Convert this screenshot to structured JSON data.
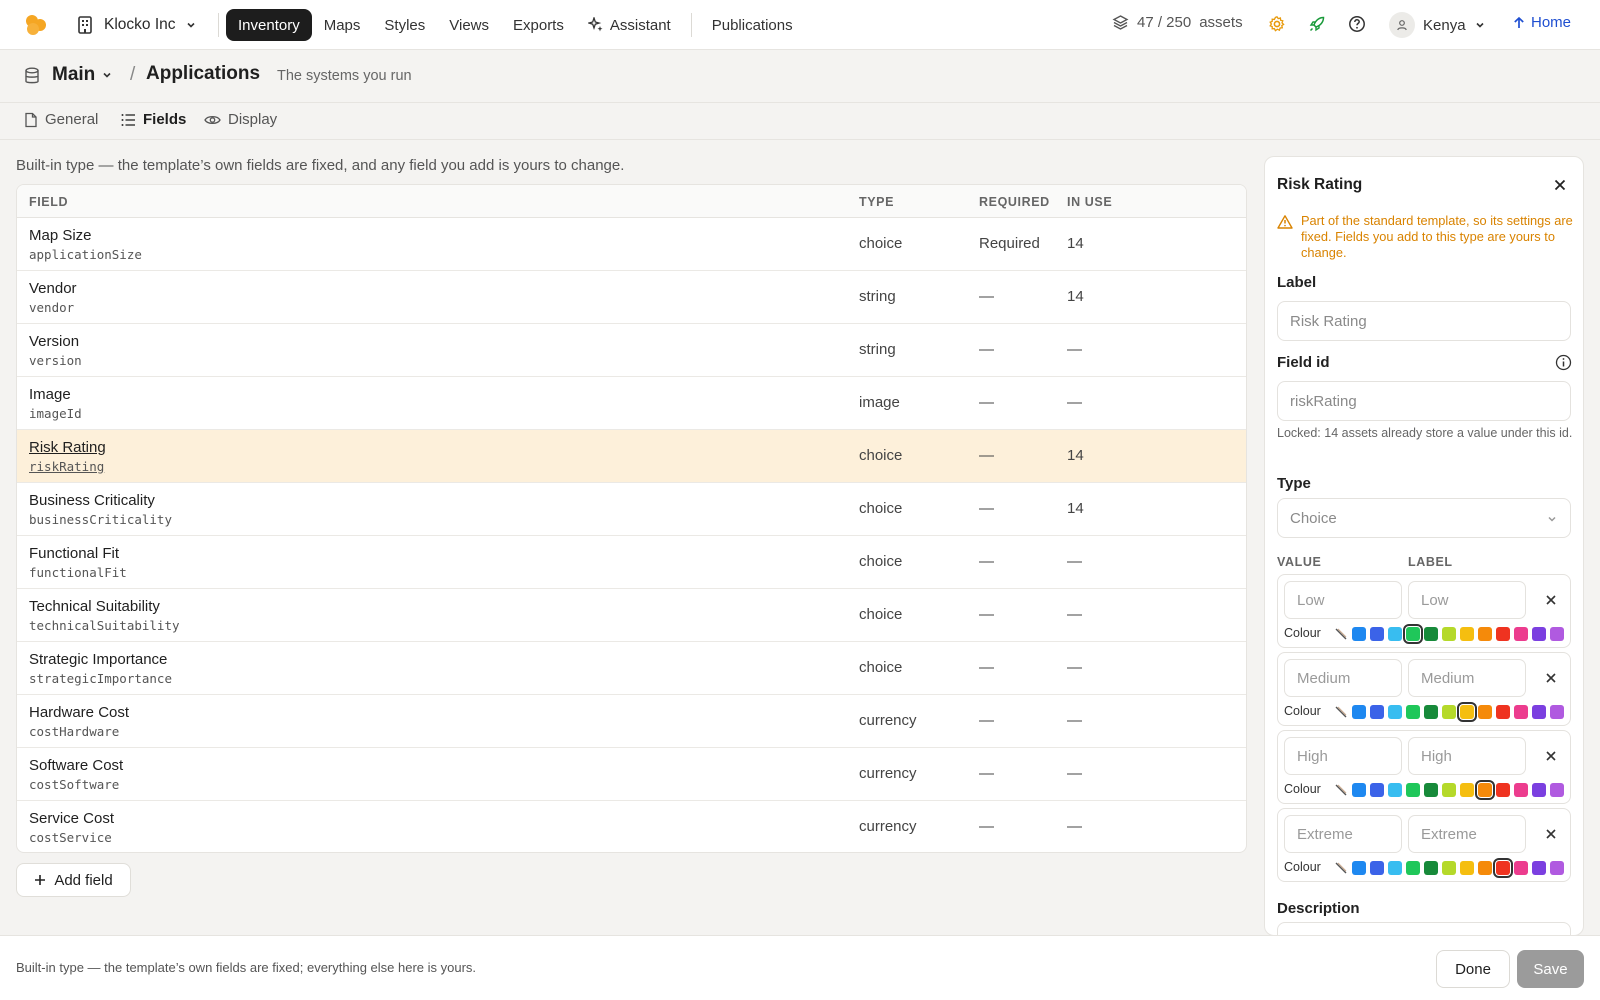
{
  "topbar": {
    "org": "Klocko Inc",
    "nav": [
      {
        "label": "Inventory",
        "active": true
      },
      {
        "label": "Maps"
      },
      {
        "label": "Styles"
      },
      {
        "label": "Views"
      },
      {
        "label": "Exports"
      },
      {
        "label": "Assistant"
      },
      {
        "label": "Publications"
      }
    ],
    "assets_count": "47 / 250",
    "assets_label": "assets",
    "user": "Kenya",
    "home": "Home"
  },
  "breadcrumb": {
    "root": "Main",
    "separator": "/",
    "page": "Applications",
    "subtitle": "The systems you run"
  },
  "tabs": [
    {
      "label": "General",
      "icon": "file-icon"
    },
    {
      "label": "Fields",
      "icon": "list-icon",
      "active": true
    },
    {
      "label": "Display",
      "icon": "eye-icon"
    }
  ],
  "notice": "Built-in type — the template’s own fields are fixed, and any field you add is yours to change.",
  "table": {
    "headers": {
      "field": "FIELD",
      "type": "TYPE",
      "required": "REQUIRED",
      "in_use": "IN USE"
    },
    "rows": [
      {
        "name": "Map Size",
        "id": "applicationSize",
        "type": "choice",
        "required": "Required",
        "in_use": "14"
      },
      {
        "name": "Vendor",
        "id": "vendor",
        "type": "string",
        "required": "—",
        "in_use": "14"
      },
      {
        "name": "Version",
        "id": "version",
        "type": "string",
        "required": "—",
        "in_use": "—"
      },
      {
        "name": "Image",
        "id": "imageId",
        "type": "image",
        "required": "—",
        "in_use": "—"
      },
      {
        "name": "Risk Rating",
        "id": "riskRating",
        "type": "choice",
        "required": "—",
        "in_use": "14",
        "selected": true
      },
      {
        "name": "Business Criticality",
        "id": "businessCriticality",
        "type": "choice",
        "required": "—",
        "in_use": "14"
      },
      {
        "name": "Functional Fit",
        "id": "functionalFit",
        "type": "choice",
        "required": "—",
        "in_use": "—"
      },
      {
        "name": "Technical Suitability",
        "id": "technicalSuitability",
        "type": "choice",
        "required": "—",
        "in_use": "—"
      },
      {
        "name": "Strategic Importance",
        "id": "strategicImportance",
        "type": "choice",
        "required": "—",
        "in_use": "—"
      },
      {
        "name": "Hardware Cost",
        "id": "costHardware",
        "type": "currency",
        "required": "—",
        "in_use": "—"
      },
      {
        "name": "Software Cost",
        "id": "costSoftware",
        "type": "currency",
        "required": "—",
        "in_use": "—"
      },
      {
        "name": "Service Cost",
        "id": "costService",
        "type": "currency",
        "required": "—",
        "in_use": "—"
      }
    ]
  },
  "add_field": "Add field",
  "panel": {
    "title": "Risk Rating",
    "warning": "Part of the standard template, so its settings are fixed. Fields you add to this type are yours to change.",
    "label_title": "Label",
    "label_value": "Risk Rating",
    "fieldid_title": "Field id",
    "fieldid_value": "riskRating",
    "fieldid_hint": "Locked: 14 assets already store a value under this id.",
    "type_title": "Type",
    "type_value": "Choice",
    "value_header": "VALUE",
    "label_header": "LABEL",
    "colour_label": "Colour",
    "palette": [
      "#1e88f0",
      "#3b63e8",
      "#38bdf0",
      "#1fc75a",
      "#178a3a",
      "#b5d92a",
      "#f5be10",
      "#f58a0a",
      "#ef3320",
      "#ec3c8e",
      "#7b3fe0",
      "#b05ae0"
    ],
    "options": [
      {
        "value": "Low",
        "label": "Low",
        "selected": 3
      },
      {
        "value": "Medium",
        "label": "Medium",
        "selected": 6
      },
      {
        "value": "High",
        "label": "High",
        "selected": 7
      },
      {
        "value": "Extreme",
        "label": "Extreme",
        "selected": 8
      }
    ],
    "description_title": "Description"
  },
  "bottombar": {
    "text": "Built-in type — the template’s own fields are fixed; everything else here is yours.",
    "done": "Done",
    "save": "Save"
  },
  "colors": {
    "accent": "#f5a623",
    "selected_row": "#fdf0da",
    "warning": "#d98300",
    "link": "#1f4fd1"
  }
}
